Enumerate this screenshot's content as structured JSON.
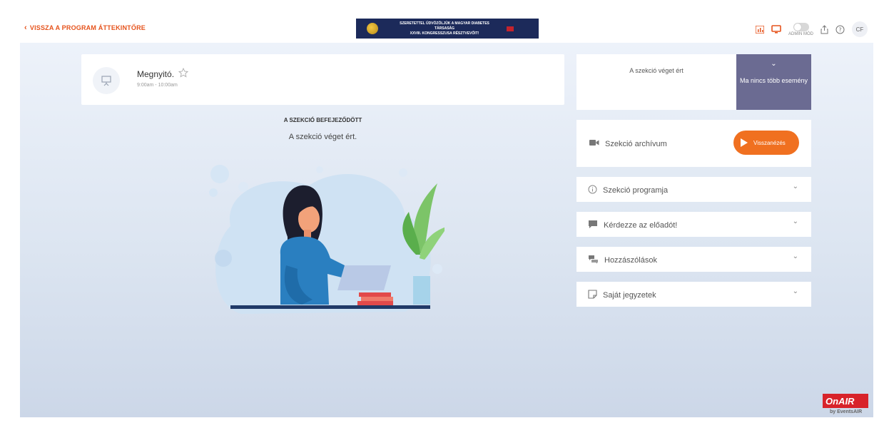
{
  "topbar": {
    "back_label": "VISSZA A PROGRAM ÁTTEKINTŐRE",
    "banner_line1": "SZERETETTEL ÜDVÖZÖLJÜK A MAGYAR DIABETES TÁRSASÁG",
    "banner_line2": "XXVIII. KONGRESSZUSA RÉSZTVEVŐIT!",
    "admin_label": "ADMIN MÓD",
    "avatar_initials": "CF"
  },
  "session": {
    "title": "Megnyitó.",
    "time": "9:00am - 10:00am",
    "status_heading": "A SZEKCIÓ BEFEJEZŐDÖTT",
    "status_text": "A szekció véget ért."
  },
  "right": {
    "ended_label": "A szekció véget ért",
    "no_more_events": "Ma nincs több esemény",
    "archive_label": "Szekció archívum",
    "replay_label": "Visszanézés",
    "panels": [
      {
        "label": "Szekció programja",
        "icon": "info-icon"
      },
      {
        "label": "Kérdezze az előadót!",
        "icon": "speech-bubble-icon"
      },
      {
        "label": "Hozzászólások",
        "icon": "chat-bubbles-icon"
      },
      {
        "label": "Saját jegyzetek",
        "icon": "note-icon"
      }
    ]
  },
  "brand": {
    "logo_text": "OnAIR",
    "by_text": "by EventsAIR"
  },
  "colors": {
    "accent": "#e6531c",
    "replay": "#f07020",
    "purple": "#6b6b92",
    "banner_bg": "#1c2a5a"
  }
}
